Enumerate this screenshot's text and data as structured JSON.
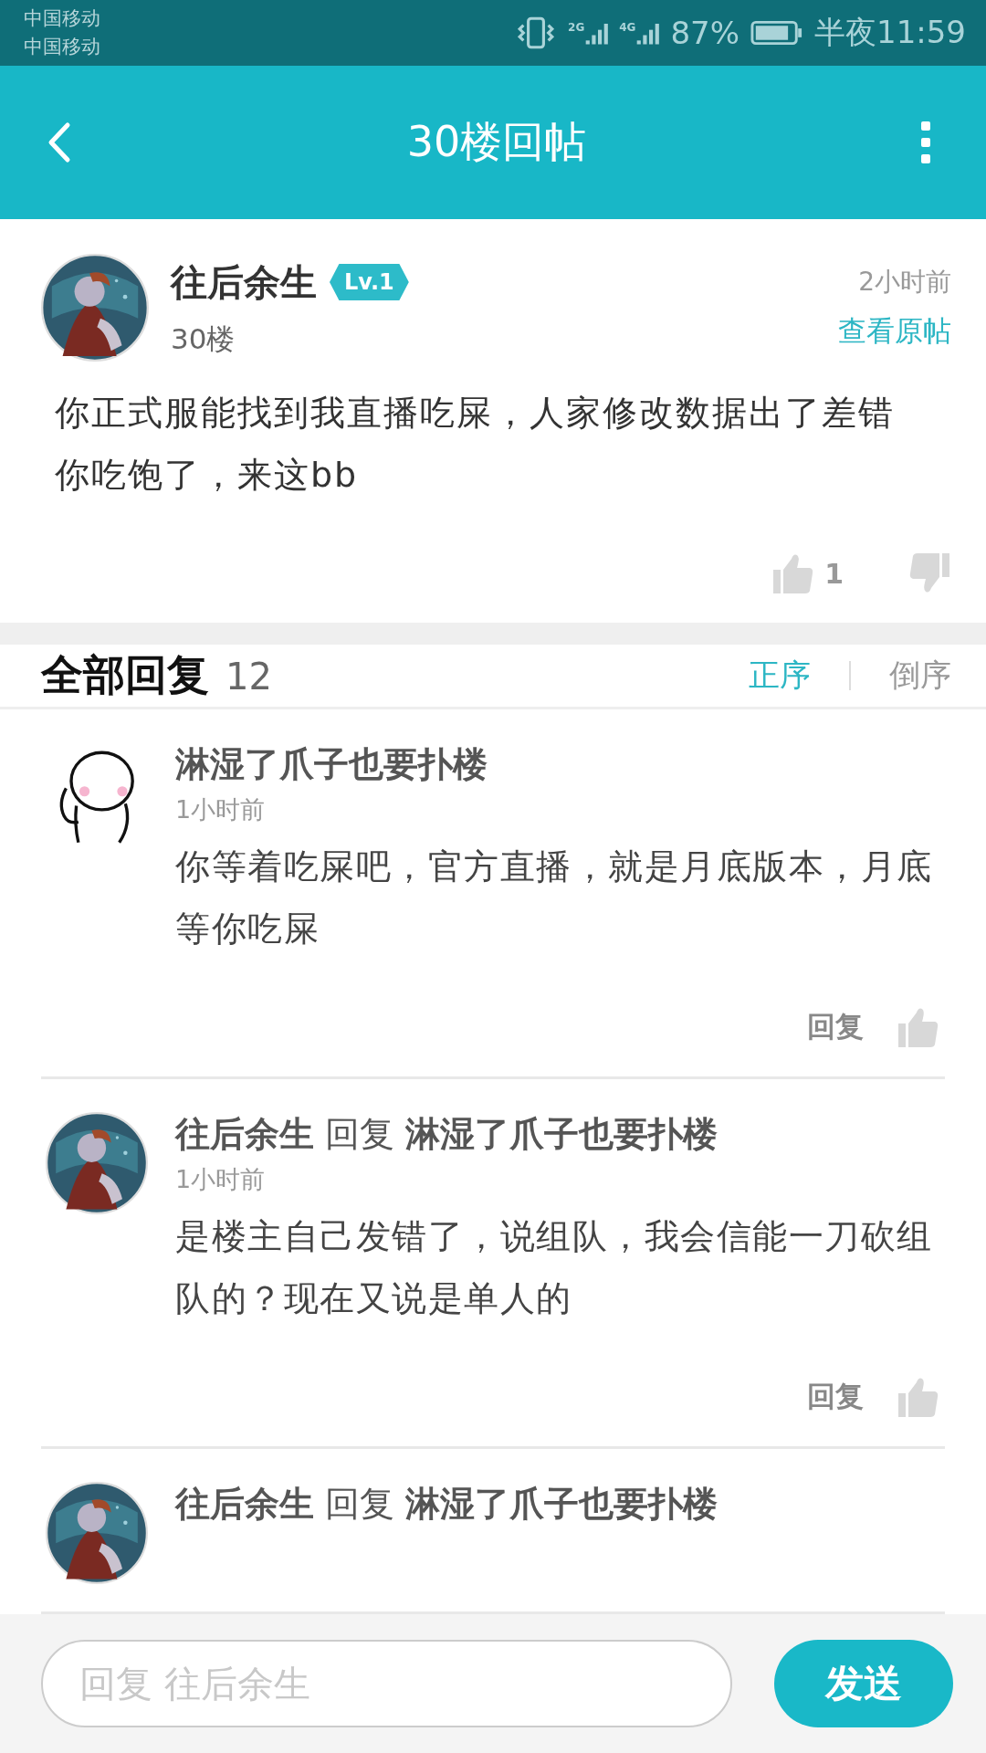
{
  "status_bar": {
    "carriers": [
      "中国移动",
      "中国移动"
    ],
    "network_labels": [
      "2G",
      "4G"
    ],
    "battery": "87%",
    "time": "半夜11:59"
  },
  "header": {
    "title": "30楼回帖"
  },
  "post": {
    "author": "往后余生",
    "level": "Lv.1",
    "floor": "30楼",
    "time": "2小时前",
    "view_original": "查看原帖",
    "body": "你正式服能找到我直播吃屎，人家修改数据出了差错你吃饱了，来这bb",
    "likes": "1"
  },
  "replies_section": {
    "title": "全部回复",
    "count": "12",
    "sort_options": [
      {
        "label": "正序",
        "selected": true
      },
      {
        "label": "倒序",
        "selected": false
      }
    ]
  },
  "replies": [
    {
      "avatar": {
        "kind": "cartoon"
      },
      "author": "淋湿了爪子也要扑楼",
      "time": "1小时前",
      "body": "你等着吃屎吧，官方直播，就是月底版本，月底等你吃屎",
      "reply_button": "回复"
    },
    {
      "author": "往后余生",
      "reply_word": "回复",
      "target": "淋湿了爪子也要扑楼",
      "time": "1小时前",
      "body": "是楼主自己发错了，说组队，我会信能一刀砍组队的？现在又说是单人的",
      "reply_button": "回复"
    },
    {
      "author": "往后余生",
      "reply_word": "回复",
      "target": "淋湿了爪子也要扑楼"
    }
  ],
  "composer": {
    "placeholder": "回复 往后余生",
    "send": "发送"
  }
}
